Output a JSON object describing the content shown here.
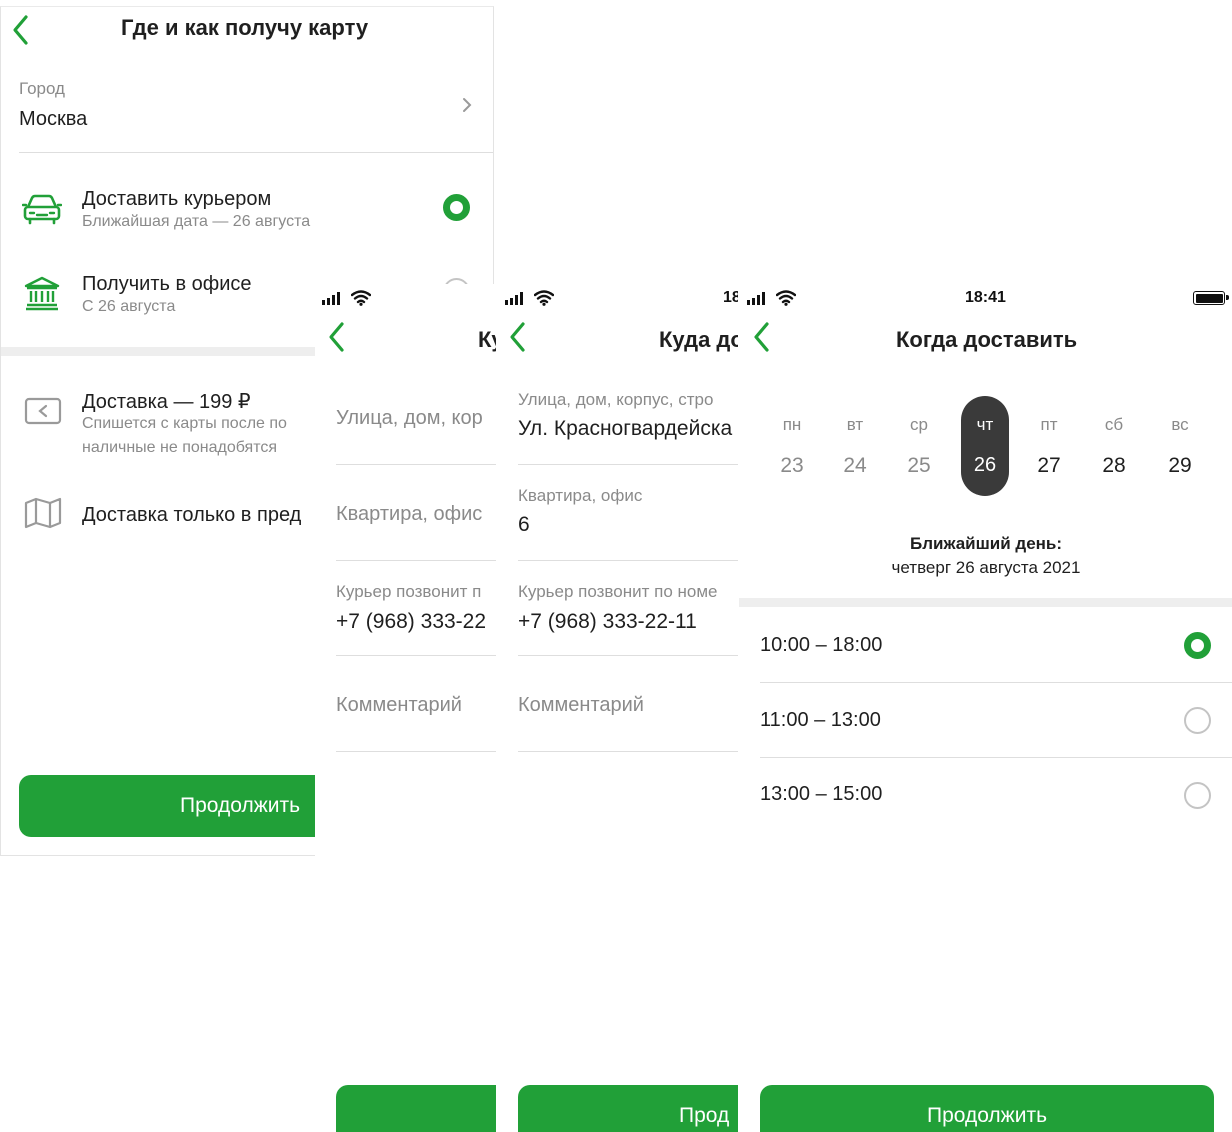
{
  "screen1": {
    "title": "Где и как получу карту",
    "city_label": "Город",
    "city_value": "Москва",
    "options": [
      {
        "title": "Доставить курьером",
        "subtitle": "Ближайшая дата — 26 августа",
        "icon": "car-icon",
        "selected": true
      },
      {
        "title": "Получить в офисе",
        "subtitle": "С 26 августа",
        "icon": "bank-icon",
        "selected": false
      }
    ],
    "delivery_cost_title": "Доставка — 199 ₽",
    "delivery_cost_sub_line1": "Спишется с карты после по",
    "delivery_cost_sub_line2": "наличные не понадобятся",
    "delivery_region": "Доставка только в пред",
    "continue_label": "Продолжить"
  },
  "screen2": {
    "title": "Ку",
    "street_placeholder": "Улица, дом, кор",
    "apartment_placeholder": "Квартира, офис",
    "phone_label": "Курьер позвонит п",
    "phone_value": "+7 (968) 333-22",
    "comment_placeholder": "Комментарий"
  },
  "screen3": {
    "time": "18",
    "title": "Куда до",
    "street_label": "Улица, дом, корпус, стро",
    "street_value": "Ул. Красногвардейска",
    "apartment_label": "Квартира, офис",
    "apartment_value": "6",
    "phone_label": "Курьер позвонит по номе",
    "phone_value": "+7 (968) 333-22-11",
    "comment_placeholder": "Комментарий",
    "continue_label": "Прод"
  },
  "screen4": {
    "time": "18:41",
    "title": "Когда доставить",
    "days": [
      {
        "dow": "пн",
        "num": "23",
        "available": false
      },
      {
        "dow": "вт",
        "num": "24",
        "available": false
      },
      {
        "dow": "ср",
        "num": "25",
        "available": false
      },
      {
        "dow": "чт",
        "num": "26",
        "available": true,
        "selected": true
      },
      {
        "dow": "пт",
        "num": "27",
        "available": true
      },
      {
        "dow": "сб",
        "num": "28",
        "available": true
      },
      {
        "dow": "вс",
        "num": "29",
        "available": true
      }
    ],
    "nearest_label": "Ближайший день:",
    "nearest_value": "четверг 26 августа 2021",
    "slots": [
      {
        "label": "10:00 – 18:00",
        "selected": true
      },
      {
        "label": "11:00 – 13:00",
        "selected": false
      },
      {
        "label": "13:00 – 15:00",
        "selected": false
      }
    ],
    "continue_label": "Продолжить"
  },
  "colors": {
    "accent": "#21a038",
    "selected_day_bg": "#3a3a3a",
    "muted_text": "#8a8a8a"
  }
}
